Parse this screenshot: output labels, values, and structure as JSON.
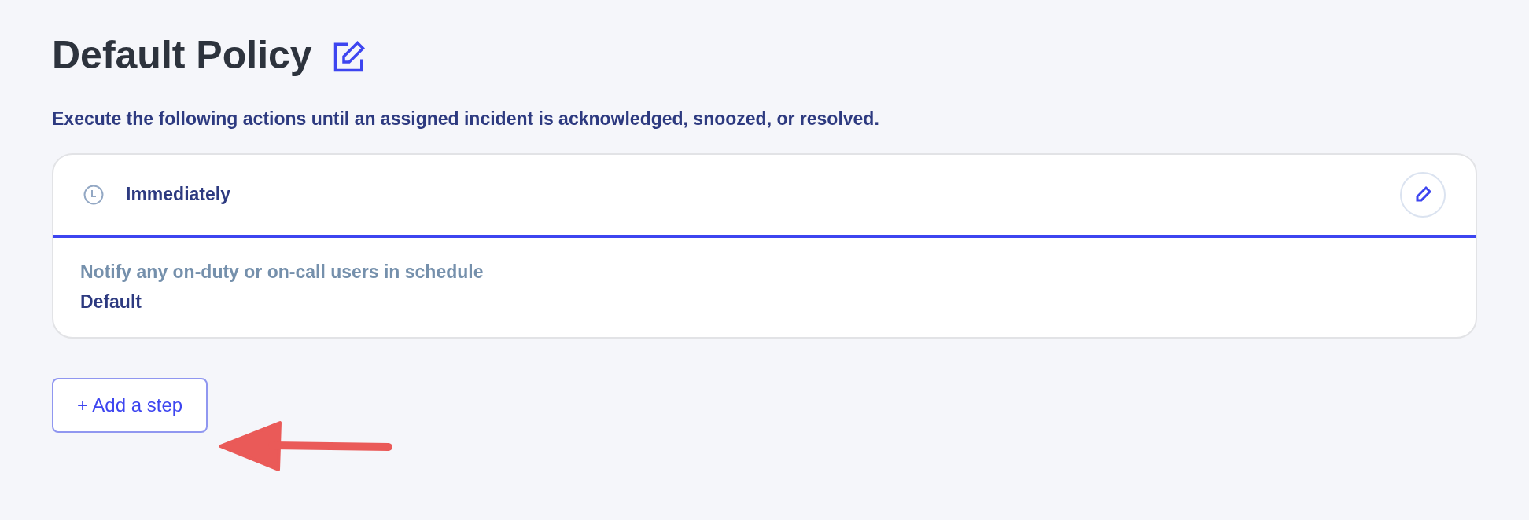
{
  "title": "Default Policy",
  "description": "Execute the following actions until an assigned incident is acknowledged, snoozed, or resolved.",
  "steps": [
    {
      "timing": "Immediately",
      "action": "Notify any on-duty or on-call users in schedule",
      "target": "Default"
    }
  ],
  "add_button": "+ Add a step"
}
